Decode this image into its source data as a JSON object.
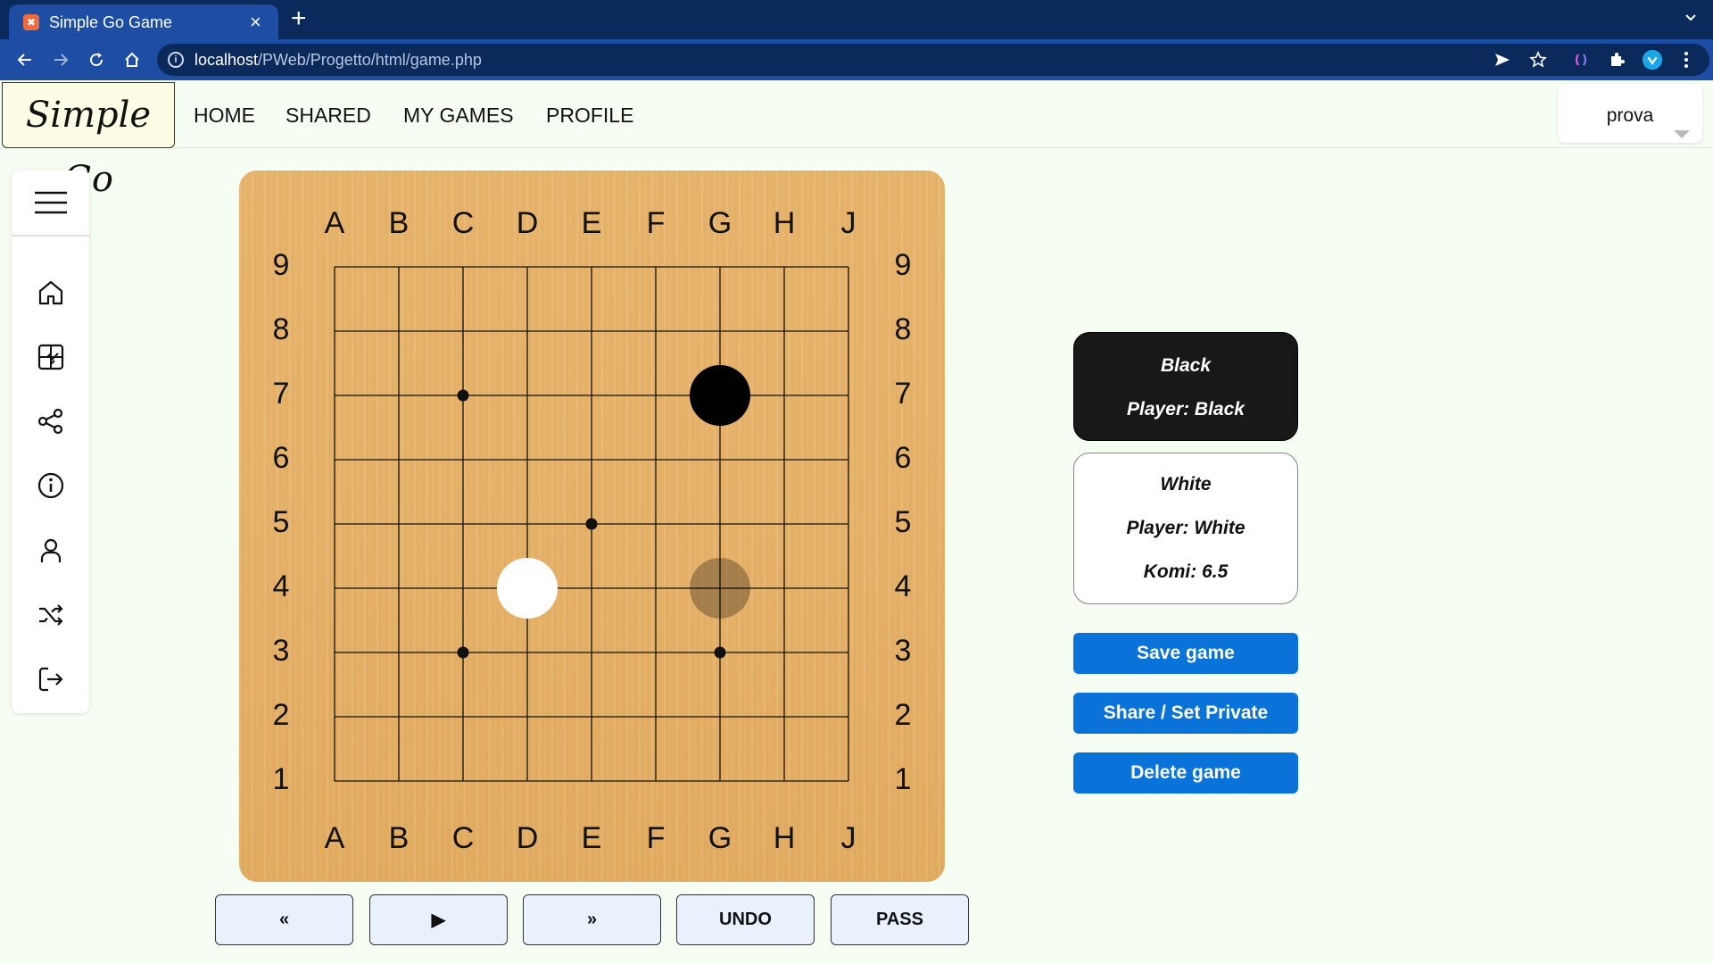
{
  "browser": {
    "tab_title": "Simple Go Game",
    "url_host": "localhost",
    "url_path": "/PWeb/Progetto/html/game.php"
  },
  "header": {
    "logo": "Simple Go",
    "nav": [
      "HOME",
      "SHARED",
      "MY GAMES",
      "PROFILE"
    ],
    "user": "prova"
  },
  "sidebar": {
    "menu_icon": "hamburger-icon",
    "items": [
      "home-icon",
      "board-icon",
      "share-icon",
      "info-icon",
      "user-icon",
      "shuffle-icon",
      "logout-icon"
    ]
  },
  "board": {
    "size": 9,
    "columns": [
      "A",
      "B",
      "C",
      "D",
      "E",
      "F",
      "G",
      "H",
      "J"
    ],
    "rows": [
      "9",
      "8",
      "7",
      "6",
      "5",
      "4",
      "3",
      "2",
      "1"
    ],
    "hoshi": [
      "C7",
      "E5",
      "C3",
      "G3"
    ],
    "stones": [
      {
        "point": "G7",
        "color": "black"
      },
      {
        "point": "D4",
        "color": "white"
      }
    ],
    "ghost": {
      "point": "G4",
      "color": "black"
    }
  },
  "players": {
    "black": {
      "title": "Black",
      "player": "Player: Black"
    },
    "white": {
      "title": "White",
      "player": "Player: White",
      "komi": "Komi: 6.5"
    }
  },
  "actions": {
    "save": "Save game",
    "share": "Share / Set Private",
    "delete": "Delete game"
  },
  "controls": {
    "first": "«",
    "play": "▶",
    "last": "»",
    "undo": "UNDO",
    "pass": "PASS"
  }
}
